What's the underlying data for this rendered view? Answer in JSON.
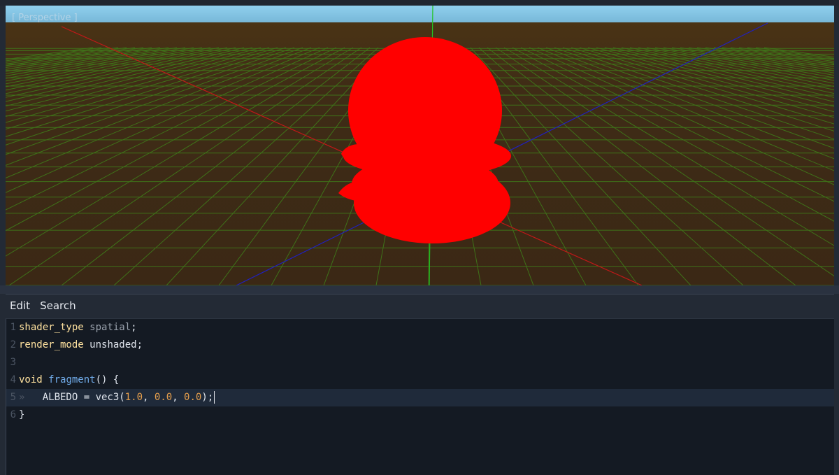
{
  "viewport": {
    "label": "[ Perspective ]",
    "sky_color": "#86c8e6",
    "ground_color": "#3e2b16",
    "grid_color": "#3f7a1a",
    "object_color": "#ff0000",
    "axis_colors": {
      "x": "#c01818",
      "y": "#22c422",
      "z": "#2020c0"
    }
  },
  "menu": {
    "edit": "Edit",
    "search": "Search"
  },
  "code": {
    "lines": [
      {
        "no": "1",
        "tokens": [
          {
            "t": "shader_type",
            "c": "kw"
          },
          {
            "t": " ",
            "c": "plain"
          },
          {
            "t": "spatial",
            "c": "ident"
          },
          {
            "t": ";",
            "c": "plain"
          }
        ]
      },
      {
        "no": "2",
        "tokens": [
          {
            "t": "render_mode",
            "c": "kw"
          },
          {
            "t": " ",
            "c": "plain"
          },
          {
            "t": "unshaded",
            "c": "plain"
          },
          {
            "t": ";",
            "c": "plain"
          }
        ]
      },
      {
        "no": "3",
        "tokens": []
      },
      {
        "no": "4",
        "tokens": [
          {
            "t": "void",
            "c": "kw2"
          },
          {
            "t": " ",
            "c": "plain"
          },
          {
            "t": "fragment",
            "c": "fn"
          },
          {
            "t": "() {",
            "c": "plain"
          }
        ]
      },
      {
        "no": "5",
        "current": true,
        "tokens": [
          {
            "t": "»   ",
            "c": "tab"
          },
          {
            "t": "ALBEDO = vec3(",
            "c": "plain"
          },
          {
            "t": "1.0",
            "c": "num"
          },
          {
            "t": ", ",
            "c": "plain"
          },
          {
            "t": "0.0",
            "c": "num"
          },
          {
            "t": ", ",
            "c": "plain"
          },
          {
            "t": "0.0",
            "c": "num"
          },
          {
            "t": ");",
            "c": "plain"
          }
        ]
      },
      {
        "no": "6",
        "tokens": [
          {
            "t": "}",
            "c": "plain"
          }
        ]
      }
    ]
  }
}
